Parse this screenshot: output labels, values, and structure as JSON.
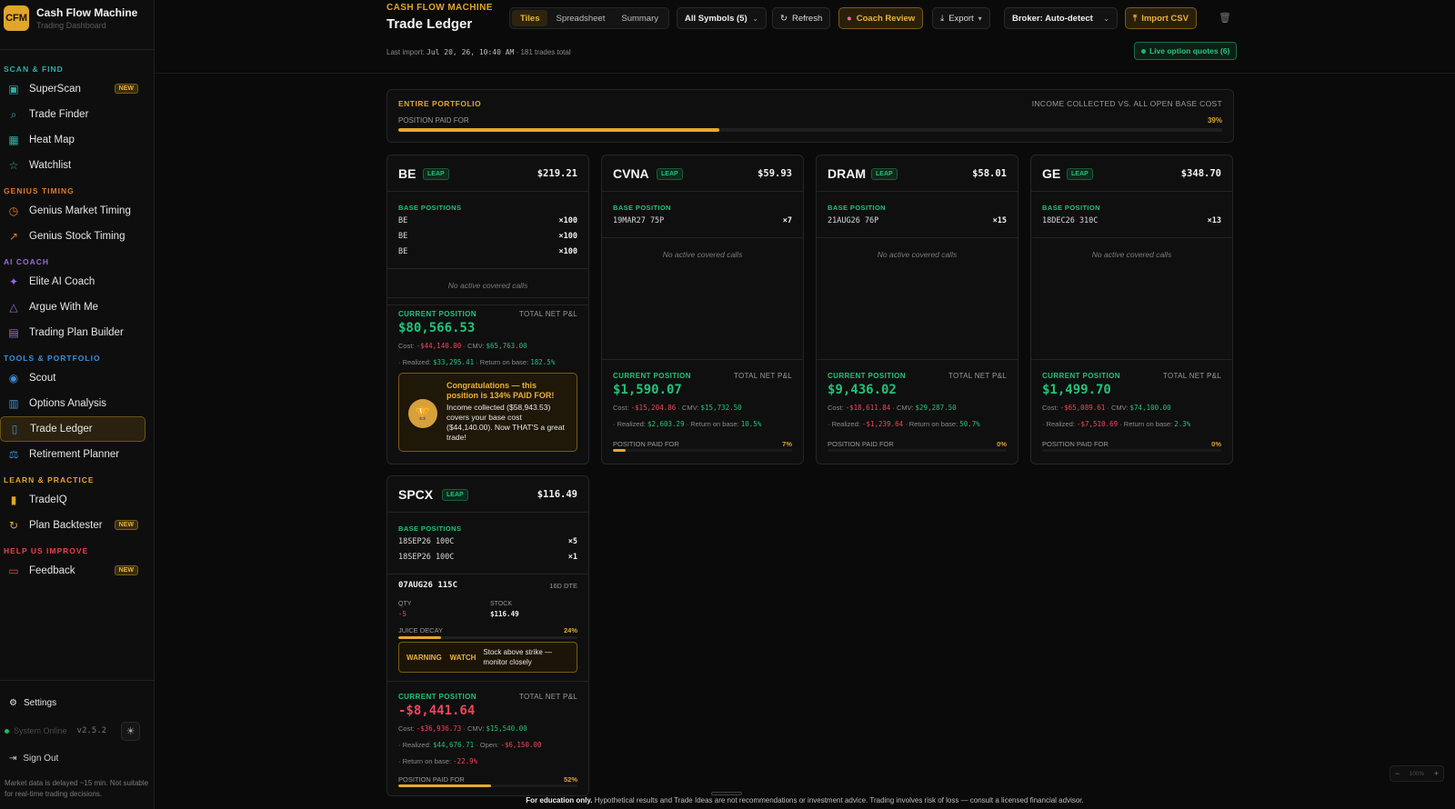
{
  "sidebar": {
    "logo": "CFM",
    "title": "Cash Flow Machine",
    "subtitle": "Trading Dashboard",
    "sections": [
      {
        "label": "SCAN & FIND",
        "color": "#2bb0a6",
        "items": [
          {
            "label": "SuperScan",
            "icon": "scan-icon",
            "badge": "NEW"
          },
          {
            "label": "Trade Finder",
            "icon": "search-icon"
          },
          {
            "label": "Heat Map",
            "icon": "grid-icon"
          },
          {
            "label": "Watchlist",
            "icon": "star-icon"
          }
        ]
      },
      {
        "label": "GENIUS TIMING",
        "color": "#e07a2a",
        "items": [
          {
            "label": "Genius Market Timing",
            "icon": "clock-icon"
          },
          {
            "label": "Genius Stock Timing",
            "icon": "trend-icon"
          }
        ]
      },
      {
        "label": "AI COACH",
        "color": "#9b6ad8",
        "items": [
          {
            "label": "Elite AI Coach",
            "icon": "sparkle-icon"
          },
          {
            "label": "Argue With Me",
            "icon": "triangle-icon"
          },
          {
            "label": "Trading Plan Builder",
            "icon": "clipboard-icon"
          }
        ]
      },
      {
        "label": "TOOLS & PORTFOLIO",
        "color": "#3a8fd8",
        "items": [
          {
            "label": "Scout",
            "icon": "eye-icon"
          },
          {
            "label": "Options Analysis",
            "icon": "chart-icon"
          },
          {
            "label": "Trade Ledger",
            "icon": "book-icon",
            "active": true
          },
          {
            "label": "Retirement Planner",
            "icon": "scale-icon"
          }
        ]
      },
      {
        "label": "LEARN & PRACTICE",
        "color": "#e0a52a",
        "items": [
          {
            "label": "TradeIQ",
            "icon": "bars-icon"
          },
          {
            "label": "Plan Backtester",
            "icon": "refresh-icon",
            "badge": "NEW"
          }
        ]
      },
      {
        "label": "HELP US IMPROVE",
        "color": "#e0454a",
        "items": [
          {
            "label": "Feedback",
            "icon": "message-icon",
            "badge": "NEW"
          }
        ]
      }
    ],
    "settings": "Settings",
    "status": "System Online",
    "version": "v2.5.2",
    "sign_out": "Sign Out",
    "delay_note": "Market data is delayed ~15 min. Not suitable for real-time trading decisions."
  },
  "header": {
    "kicker": "CASH FLOW MACHINE",
    "title": "Trade Ledger",
    "last_import_label": "Last import:",
    "last_import_value": "Jul 20, 26, 10:40 AM",
    "trades_total": "· 181 trades total",
    "views": [
      "Tiles",
      "Spreadsheet",
      "Summary"
    ],
    "active_view": "Tiles",
    "symbols_select": "All Symbols (5)",
    "refresh": "Refresh",
    "coach_review": "Coach Review",
    "export": "Export",
    "broker_select": "Broker: Auto-detect",
    "import_csv": "Import CSV",
    "live_quotes": "Live option quotes (6)"
  },
  "portfolio": {
    "label": "ENTIRE PORTFOLIO",
    "right_label": "INCOME COLLECTED VS. ALL OPEN BASE COST",
    "paid_label": "POSITION PAID FOR",
    "paid_pct_text": "39%",
    "paid_fraction": 0.39
  },
  "cards": [
    {
      "symbol": "BE",
      "tag": "LEAP",
      "price": "$219.21",
      "base_label": "BASE POSITIONS",
      "positions": [
        {
          "name": "BE",
          "qty": "×100"
        },
        {
          "name": "BE",
          "qty": "×100"
        },
        {
          "name": "BE",
          "qty": "×100"
        }
      ],
      "covered": "No active covered calls",
      "current_label": "CURRENT POSITION",
      "pnl_label": "TOTAL NET P&L",
      "pnl": "$80,566.53",
      "pnl_sign": "pos",
      "cost_label": "Cost:",
      "cost": "-$44,140.00",
      "cmv_label": "· CMV:",
      "cmv": "$65,763.00",
      "realized_label": "· Realized:",
      "realized": "$33,295.41",
      "realized_sign": "pos",
      "rob_label": "· Return on base:",
      "rob": "182.5%",
      "rob_sign": "pos",
      "congrats_title": "Congratulations — this position is 134% PAID FOR!",
      "congrats_body": "Income collected ($58,943.53) covers your base cost ($44,140.00). Now THAT'S a great trade!"
    },
    {
      "symbol": "CVNA",
      "tag": "LEAP",
      "price": "$59.93",
      "base_label": "BASE POSITION",
      "positions": [
        {
          "name": "19MAR27 75P",
          "qty": "×7"
        }
      ],
      "covered": "No active covered calls",
      "current_label": "CURRENT POSITION",
      "pnl_label": "TOTAL NET P&L",
      "pnl": "$1,590.07",
      "pnl_sign": "pos",
      "cost_label": "Cost:",
      "cost": "-$15,204.86",
      "cmv_label": "· CMV:",
      "cmv": "$15,732.50",
      "realized_label": "· Realized:",
      "realized": "$2,603.29",
      "realized_sign": "pos",
      "rob_label": "· Return on base:",
      "rob": "10.5%",
      "rob_sign": "pos",
      "paid_label": "POSITION PAID FOR",
      "paid_text": "7%",
      "paid_fraction": 0.07
    },
    {
      "symbol": "DRAM",
      "tag": "LEAP",
      "price": "$58.01",
      "base_label": "BASE POSITION",
      "positions": [
        {
          "name": "21AUG26 76P",
          "qty": "×15"
        }
      ],
      "covered": "No active covered calls",
      "current_label": "CURRENT POSITION",
      "pnl_label": "TOTAL NET P&L",
      "pnl": "$9,436.02",
      "pnl_sign": "pos",
      "cost_label": "Cost:",
      "cost": "-$18,611.84",
      "cmv_label": "· CMV:",
      "cmv": "$29,287.50",
      "realized_label": "· Realized:",
      "realized": "-$1,239.64",
      "realized_sign": "neg",
      "rob_label": "· Return on base:",
      "rob": "50.7%",
      "rob_sign": "pos",
      "paid_label": "POSITION PAID FOR",
      "paid_text": "0%",
      "paid_fraction": 0
    },
    {
      "symbol": "GE",
      "tag": "LEAP",
      "price": "$348.70",
      "base_label": "BASE POSITION",
      "positions": [
        {
          "name": "18DEC26 310C",
          "qty": "×13"
        }
      ],
      "covered": "No active covered calls",
      "current_label": "CURRENT POSITION",
      "pnl_label": "TOTAL NET P&L",
      "pnl": "$1,499.70",
      "pnl_sign": "pos",
      "cost_label": "Cost:",
      "cost": "-$65,089.61",
      "cmv_label": "· CMV:",
      "cmv": "$74,100.00",
      "realized_label": "· Realized:",
      "realized": "-$7,510.69",
      "realized_sign": "neg",
      "rob_label": "· Return on base:",
      "rob": "2.3%",
      "rob_sign": "pos",
      "paid_label": "POSITION PAID FOR",
      "paid_text": "0%",
      "paid_fraction": 0
    },
    {
      "symbol": "SPCX",
      "tag": "LEAP",
      "price": "$116.49",
      "base_label": "BASE POSITIONS",
      "positions": [
        {
          "name": "18SEP26 100C",
          "qty": "×5"
        },
        {
          "name": "18SEP26 100C",
          "qty": "×1"
        }
      ],
      "call": {
        "name": "07AUG26 115C",
        "dte": "16D DTE",
        "qty_label": "QTY",
        "qty": "-5",
        "stock_label": "STOCK",
        "stock": "$116.49",
        "decay_label": "JUICE DECAY",
        "decay_text": "24%",
        "decay_fraction": 0.24,
        "warn1": "WARNING",
        "warn2": "WATCH",
        "warn_text": "Stock above strike — monitor closely"
      },
      "current_label": "CURRENT POSITION",
      "pnl_label": "TOTAL NET P&L",
      "pnl": "-$8,441.64",
      "pnl_sign": "neg",
      "cost_label": "Cost:",
      "cost": "-$36,936.73",
      "cmv_label": "· CMV:",
      "cmv": "$15,540.00",
      "realized_label": "· Realized:",
      "realized": "$44,676.71",
      "realized_sign": "pos",
      "open_label": "· Open:",
      "open": "-$6,150.00",
      "rob_label": "· Return on base:",
      "rob": "-22.9%",
      "rob_sign": "neg",
      "paid_label": "POSITION PAID FOR",
      "paid_text": "52%",
      "paid_fraction": 0.52
    }
  ],
  "footer": {
    "bold": "For education only.",
    "text": "Hypothetical results and Trade Ideas are not recommendations or investment advice. Trading involves risk of loss — consult a licensed financial advisor."
  },
  "zoom": {
    "minus": "−",
    "level": "100%",
    "plus": "+"
  }
}
